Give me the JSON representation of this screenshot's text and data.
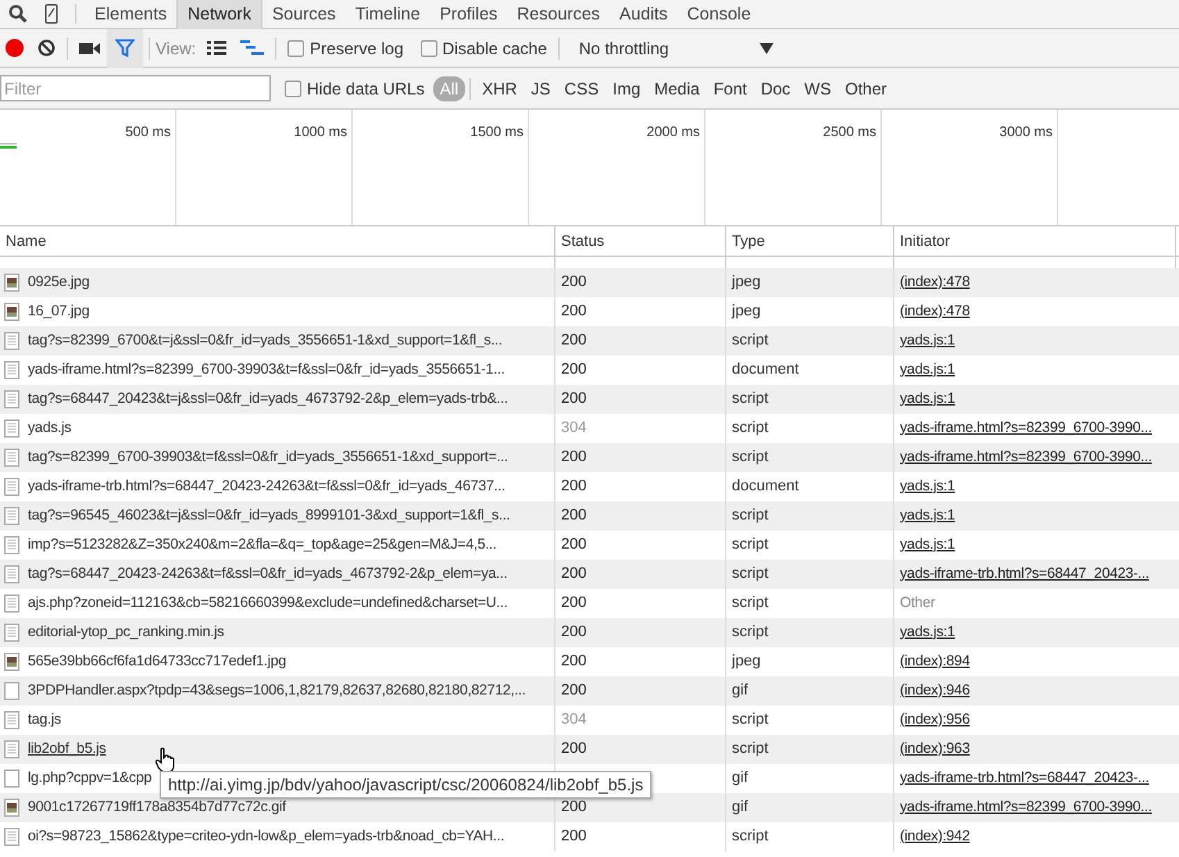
{
  "tabs": [
    {
      "label": "Elements",
      "selected": false
    },
    {
      "label": "Network",
      "selected": true
    },
    {
      "label": "Sources",
      "selected": false
    },
    {
      "label": "Timeline",
      "selected": false
    },
    {
      "label": "Profiles",
      "selected": false
    },
    {
      "label": "Resources",
      "selected": false
    },
    {
      "label": "Audits",
      "selected": false
    },
    {
      "label": "Console",
      "selected": false
    }
  ],
  "toolbar": {
    "recording": true,
    "filter_on": true,
    "view_label": "View:",
    "preserve_log": {
      "label": "Preserve log",
      "checked": false
    },
    "disable_cache": {
      "label": "Disable cache",
      "checked": false
    },
    "throttling": "No throttling"
  },
  "filter_bar": {
    "placeholder": "Filter",
    "hide_data_urls": {
      "label": "Hide data URLs",
      "checked": false
    },
    "types": [
      {
        "label": "All",
        "selected": true
      },
      {
        "label": "XHR",
        "selected": false
      },
      {
        "label": "JS",
        "selected": false
      },
      {
        "label": "CSS",
        "selected": false
      },
      {
        "label": "Img",
        "selected": false
      },
      {
        "label": "Media",
        "selected": false
      },
      {
        "label": "Font",
        "selected": false
      },
      {
        "label": "Doc",
        "selected": false
      },
      {
        "label": "WS",
        "selected": false
      },
      {
        "label": "Other",
        "selected": false
      }
    ]
  },
  "overview": {
    "ticks": [
      "500 ms",
      "1000 ms",
      "1500 ms",
      "2000 ms",
      "2500 ms",
      "3000 ms"
    ]
  },
  "table": {
    "columns": [
      "Name",
      "Status",
      "Type",
      "Initiator"
    ],
    "rows": [
      {
        "kind": "image",
        "name": "0925e.jpg",
        "status": "200",
        "type": "jpeg",
        "initiator": "(index):478",
        "link": true,
        "dimmed": false,
        "hovered": false
      },
      {
        "kind": "image",
        "name": "16_07.jpg",
        "status": "200",
        "type": "jpeg",
        "initiator": "(index):478",
        "link": true,
        "dimmed": false,
        "hovered": false
      },
      {
        "kind": "file",
        "name": "tag?s=82399_6700&t=j&ssl=0&fr_id=yads_3556651-1&xd_support=1&fl_s...",
        "status": "200",
        "type": "script",
        "initiator": "yads.js:1",
        "link": true,
        "dimmed": false,
        "hovered": false
      },
      {
        "kind": "file",
        "name": "yads-iframe.html?s=82399_6700-39903&t=f&ssl=0&fr_id=yads_3556651-1...",
        "status": "200",
        "type": "document",
        "initiator": "yads.js:1",
        "link": true,
        "dimmed": false,
        "hovered": false
      },
      {
        "kind": "file",
        "name": "tag?s=68447_20423&t=j&ssl=0&fr_id=yads_4673792-2&p_elem=yads-trb&...",
        "status": "200",
        "type": "script",
        "initiator": "yads.js:1",
        "link": true,
        "dimmed": false,
        "hovered": false
      },
      {
        "kind": "file",
        "name": "yads.js",
        "status": "304",
        "type": "script",
        "initiator": "yads-iframe.html?s=82399_6700-3990...",
        "link": true,
        "dimmed": true,
        "hovered": false
      },
      {
        "kind": "file",
        "name": "tag?s=82399_6700-39903&t=f&ssl=0&fr_id=yads_3556651-1&xd_support=...",
        "status": "200",
        "type": "script",
        "initiator": "yads-iframe.html?s=82399_6700-3990...",
        "link": true,
        "dimmed": false,
        "hovered": false
      },
      {
        "kind": "file",
        "name": "yads-iframe-trb.html?s=68447_20423-24263&t=f&ssl=0&fr_id=yads_46737...",
        "status": "200",
        "type": "document",
        "initiator": "yads.js:1",
        "link": true,
        "dimmed": false,
        "hovered": false
      },
      {
        "kind": "file",
        "name": "tag?s=96545_46023&t=j&ssl=0&fr_id=yads_8999101-3&xd_support=1&fl_s...",
        "status": "200",
        "type": "script",
        "initiator": "yads.js:1",
        "link": true,
        "dimmed": false,
        "hovered": false
      },
      {
        "kind": "file",
        "name": "imp?s=5123282&Z=350x240&m=2&fla=&q=_top&age=25&gen=M&J=4,5...",
        "status": "200",
        "type": "script",
        "initiator": "yads.js:1",
        "link": true,
        "dimmed": false,
        "hovered": false
      },
      {
        "kind": "file",
        "name": "tag?s=68447_20423-24263&t=f&ssl=0&fr_id=yads_4673792-2&p_elem=ya...",
        "status": "200",
        "type": "script",
        "initiator": "yads-iframe-trb.html?s=68447_20423-...",
        "link": true,
        "dimmed": false,
        "hovered": false
      },
      {
        "kind": "file",
        "name": "ajs.php?zoneid=112163&cb=58216660399&exclude=undefined&charset=U...",
        "status": "200",
        "type": "script",
        "initiator": "Other",
        "link": false,
        "dimmed": false,
        "hovered": false
      },
      {
        "kind": "file",
        "name": "editorial-ytop_pc_ranking.min.js",
        "status": "200",
        "type": "script",
        "initiator": "yads.js:1",
        "link": true,
        "dimmed": false,
        "hovered": false
      },
      {
        "kind": "image",
        "name": "565e39bb66cf6fa1d64733cc717edef1.jpg",
        "status": "200",
        "type": "jpeg",
        "initiator": "(index):894",
        "link": true,
        "dimmed": false,
        "hovered": false
      },
      {
        "kind": "blank",
        "name": "3PDPHandler.aspx?tpdp=43&segs=1006,1,82179,82637,82680,82180,82712,...",
        "status": "200",
        "type": "gif",
        "initiator": "(index):946",
        "link": true,
        "dimmed": false,
        "hovered": false
      },
      {
        "kind": "file",
        "name": "tag.js",
        "status": "304",
        "type": "script",
        "initiator": "(index):956",
        "link": true,
        "dimmed": true,
        "hovered": false
      },
      {
        "kind": "file",
        "name": "lib2obf_b5.js",
        "status": "200",
        "type": "script",
        "initiator": "(index):963",
        "link": true,
        "dimmed": false,
        "hovered": true
      },
      {
        "kind": "blank",
        "name": "lg.php?cppv=1&cpp",
        "type": "gif",
        "initiator": "yads-iframe-trb.html?s=68447_20423-...",
        "link": true,
        "hovered": false
      },
      {
        "kind": "image",
        "name": "9001c17267719ff178a8354b7d77c72c.gif",
        "status": "200",
        "type": "gif",
        "initiator": "yads-iframe.html?s=82399_6700-3990...",
        "link": true,
        "dimmed": false,
        "hovered": false
      },
      {
        "kind": "file",
        "name": "oi?s=98723_15862&type=criteo-ydn-low&p_elem=yads-trb&noad_cb=YAH...",
        "status": "200",
        "type": "script",
        "initiator": "(index):942",
        "link": true,
        "dimmed": false,
        "hovered": false
      }
    ]
  },
  "tooltip": "http://ai.yimg.jp/bdv/yahoo/javascript/csc/20060824/lib2obf_b5.js"
}
